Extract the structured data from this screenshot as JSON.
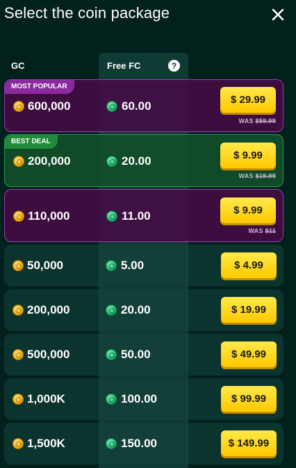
{
  "header": {
    "title": "Select the coin package",
    "close_icon": "close-icon"
  },
  "columns": {
    "gc_label": "GC",
    "fc_label": "Free FC",
    "help_glyph": "?"
  },
  "colors": {
    "accent_yellow": "#ffd000",
    "popular_purple": "#8a2a9e",
    "deal_green": "#1f8a3a",
    "background": "#02201c"
  },
  "packages": [
    {
      "badge": "MOST POPULAR",
      "gc": "600,000",
      "fc": "60.00",
      "price": "$ 29.99",
      "was_label": "WAS",
      "was_price": "$59.99"
    },
    {
      "badge": "BEST DEAL",
      "gc": "200,000",
      "fc": "20.00",
      "price": "$ 9.99",
      "was_label": "WAS",
      "was_price": "$19.99"
    },
    {
      "badge": "",
      "gc": "110,000",
      "fc": "11.00",
      "price": "$ 9.99",
      "was_label": "WAS",
      "was_price": "$11"
    },
    {
      "badge": "",
      "gc": "50,000",
      "fc": "5.00",
      "price": "$ 4.99",
      "was_label": "",
      "was_price": ""
    },
    {
      "badge": "",
      "gc": "200,000",
      "fc": "20.00",
      "price": "$ 19.99",
      "was_label": "",
      "was_price": ""
    },
    {
      "badge": "",
      "gc": "500,000",
      "fc": "50.00",
      "price": "$ 49.99",
      "was_label": "",
      "was_price": ""
    },
    {
      "badge": "",
      "gc": "1,000K",
      "fc": "100.00",
      "price": "$ 99.99",
      "was_label": "",
      "was_price": ""
    },
    {
      "badge": "",
      "gc": "1,500K",
      "fc": "150.00",
      "price": "$ 149.99",
      "was_label": "",
      "was_price": ""
    }
  ]
}
